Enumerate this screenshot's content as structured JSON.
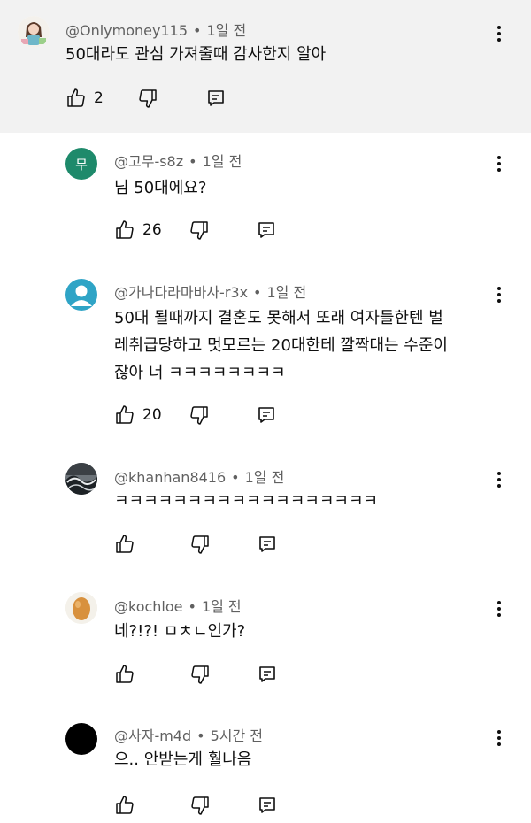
{
  "comments": [
    {
      "author": "@Onlymoney115",
      "time": "1일 전",
      "lines": [
        "50대라도 관심 가져줄때 감사한지 알아"
      ],
      "likes": "2",
      "avatar": {
        "type": "image",
        "icon": "girl-illustration-icon"
      }
    },
    {
      "author": "@고무-s8z",
      "time": "1일 전",
      "lines": [
        "님 50대에요?"
      ],
      "likes": "26",
      "avatar": {
        "type": "letter",
        "letter": "무",
        "color": "#1e8a6b"
      }
    },
    {
      "author": "@가나다라마바사-r3x",
      "time": "1일 전",
      "lines": [
        "50대 될때까지 결혼도 못해서 또래 여자들한텐 벌",
        "레취급당하고 멋모르는 20대한테 깔짝대는 수준이",
        "잖아 너 ㅋㅋㅋㅋㅋㅋㅋㅋ"
      ],
      "likes": "20",
      "avatar": {
        "type": "default",
        "color": "#2fa4c6"
      }
    },
    {
      "author": "@khanhan8416",
      "time": "1일 전",
      "lines": [
        "ㅋㅋㅋㅋㅋㅋㅋㅋㅋㅋㅋㅋㅋㅋㅋㅋㅋㅋ"
      ],
      "likes": "",
      "avatar": {
        "type": "image",
        "icon": "wave-painting-icon"
      }
    },
    {
      "author": "@kochloe",
      "time": "1일 전",
      "lines": [
        "네?!?! ㅁㅊㄴ인가?"
      ],
      "likes": "",
      "avatar": {
        "type": "image",
        "icon": "egg-icon"
      }
    },
    {
      "author": "@사자-m4d",
      "time": "5시간 전",
      "lines": [
        "으.. 안받는게 훨나음"
      ],
      "likes": "",
      "avatar": {
        "type": "solid",
        "color": "#000000"
      }
    }
  ]
}
